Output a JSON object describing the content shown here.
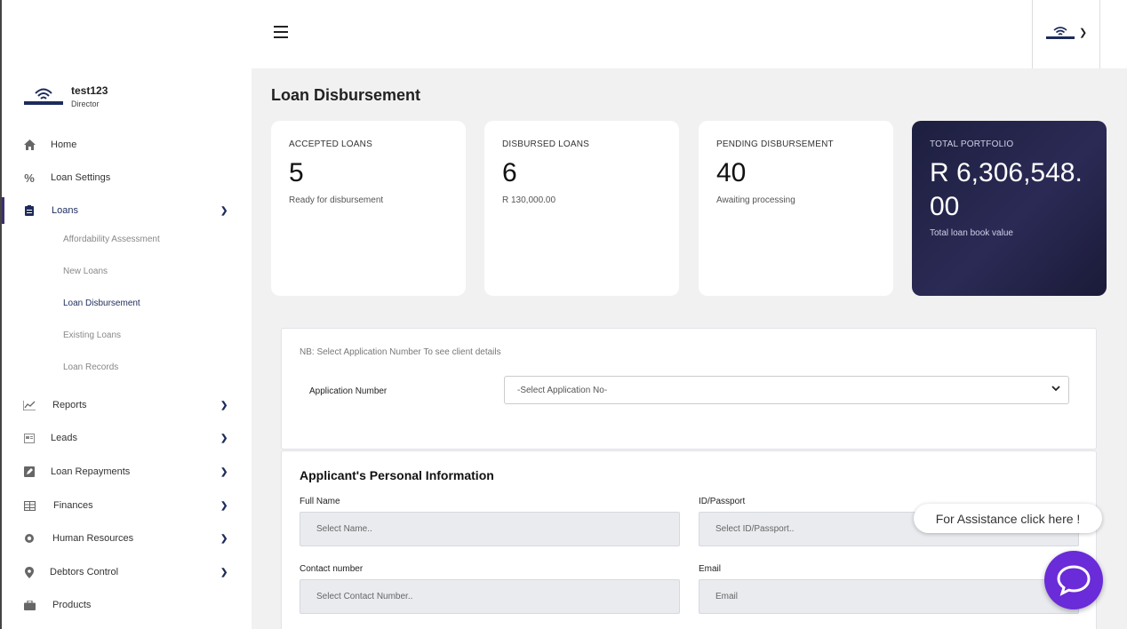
{
  "header": {
    "menu_icon": "hamburger-icon",
    "profile_logo": "connector-logo-icon",
    "profile_chevron": "chevron-down-icon"
  },
  "user": {
    "name": "test123",
    "role": "Director"
  },
  "sidebar": {
    "items": [
      {
        "label": "Home",
        "icon": "home-icon"
      },
      {
        "label": "Loan Settings",
        "icon": "percent-icon"
      },
      {
        "label": "Loans",
        "icon": "clipboard-icon"
      },
      {
        "label": "Reports",
        "icon": "chart-icon"
      },
      {
        "label": "Leads",
        "icon": "leads-icon"
      },
      {
        "label": "Loan Repayments",
        "icon": "edit-icon"
      },
      {
        "label": "Finances",
        "icon": "table-icon"
      },
      {
        "label": "Human Resources",
        "icon": "circle-icon"
      },
      {
        "label": "Debtors Control",
        "icon": "location-pin-icon"
      },
      {
        "label": "Products",
        "icon": "briefcase-icon"
      }
    ],
    "loans_sub": [
      {
        "label": "Affordability Assessment"
      },
      {
        "label": "New Loans"
      },
      {
        "label": "Loan Disbursement"
      },
      {
        "label": "Existing Loans"
      },
      {
        "label": "Loan Records"
      }
    ]
  },
  "page": {
    "title": "Loan Disbursement"
  },
  "cards": [
    {
      "label": "ACCEPTED LOANS",
      "value": "5",
      "sub": "Ready for disbursement"
    },
    {
      "label": "DISBURSED LOANS",
      "value": "6",
      "sub": "R 130,000.00"
    },
    {
      "label": "PENDING DISBURSEMENT",
      "value": "40",
      "sub": "Awaiting processing"
    },
    {
      "label": "TOTAL PORTFOLIO",
      "value": "R 6,306,548.00",
      "sub": "Total loan book value"
    }
  ],
  "application": {
    "note": "NB: Select Application Number To see client details",
    "label": "Application Number",
    "selected": "-Select Application No-"
  },
  "personal": {
    "title": "Applicant's Personal Information",
    "full_name_label": "Full Name",
    "full_name_placeholder": "Select Name..",
    "id_label": "ID/Passport",
    "id_placeholder": "Select ID/Passport..",
    "contact_label": "Contact number",
    "contact_placeholder": "Select Contact Number..",
    "email_label": "Email",
    "email_placeholder": "Email"
  },
  "assist": {
    "label": "For Assistance click here !"
  },
  "colors": {
    "accent": "#1d2b5c",
    "dark_card": "#1d1f3f",
    "chat": "#6a2bd8"
  }
}
